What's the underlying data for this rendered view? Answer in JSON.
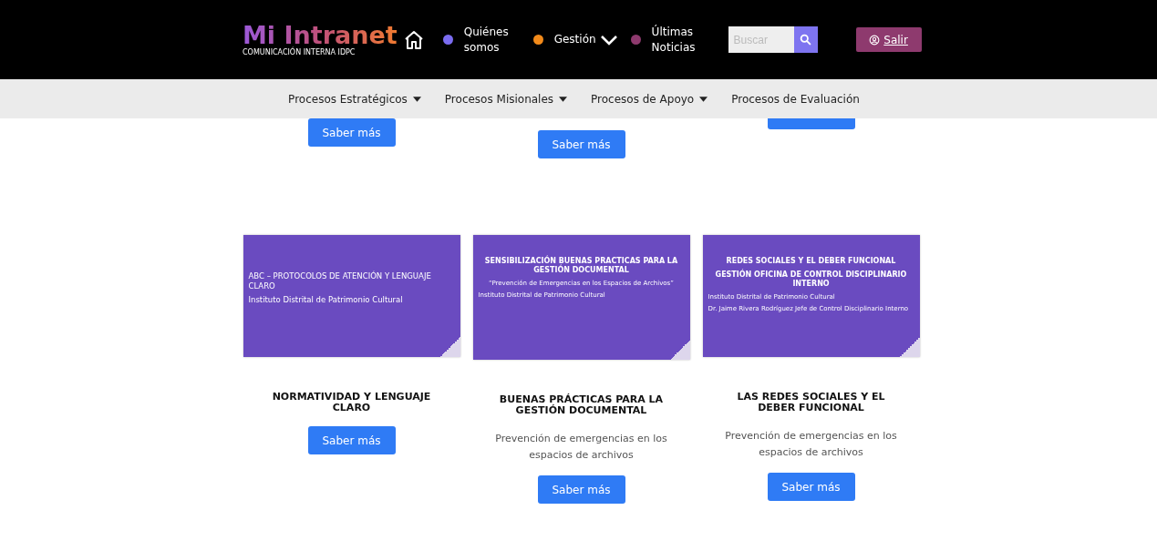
{
  "header": {
    "logo": {
      "title": "Mi Intranet",
      "subtitle": "COMUNICACIÓN INTERNA IDPC"
    },
    "nav": [
      {
        "label": "Quiénes somos",
        "color": "#7b6cf0",
        "dropdown": false
      },
      {
        "label": "Gestión",
        "color": "#f28a1a",
        "dropdown": true
      },
      {
        "label": "Últimas Noticias",
        "color": "#8e3a6e",
        "dropdown": false
      }
    ],
    "search": {
      "placeholder": "Buscar"
    },
    "logout": {
      "label": "Salir"
    }
  },
  "subnav": [
    {
      "label": "Procesos Estratégicos",
      "dropdown": true
    },
    {
      "label": "Procesos Misionales",
      "dropdown": true
    },
    {
      "label": "Procesos de Apoyo",
      "dropdown": true
    },
    {
      "label": "Procesos de Evaluación",
      "dropdown": false
    }
  ],
  "top_buttons": [
    {
      "kind": "full",
      "label": "Saber más"
    },
    {
      "kind": "full",
      "label": "Saber más"
    },
    {
      "kind": "clipped"
    }
  ],
  "cards": [
    {
      "slide": {
        "lines": [
          {
            "kind": "title",
            "text": "ABC – PROTOCOLOS DE ATENCIÓN Y LENGUAJE CLARO"
          },
          {
            "kind": "subtitle",
            "text": "Instituto Distrital de Patrimonio Cultural"
          }
        ]
      },
      "title": "NORMATIVIDAD Y LENGUAJE CLARO",
      "button": "Saber más"
    },
    {
      "slide": {
        "lines": [
          {
            "kind": "title",
            "text": "SENSIBILIZACIÓN BUENAS PRACTICAS PARA LA  GESTIÓN DOCUMENTAL"
          },
          {
            "kind": "quote",
            "text": "“Prevención de Emergencias en los Espacios de Archivos”"
          },
          {
            "kind": "credit",
            "text": "Instituto Distrital de Patrimonio Cultural"
          }
        ]
      },
      "title": "BUENAS PRÁCTICAS PARA LA GESTIÓN DOCUMENTAL",
      "description": "Prevención de emergencias en los espacios de archivos",
      "button": "Saber más"
    },
    {
      "slide": {
        "lines": [
          {
            "kind": "title",
            "text": "REDES SOCIALES Y EL DEBER FUNCIONAL"
          },
          {
            "kind": "title",
            "text": "GESTIÓN OFICINA DE CONTROL DISCIPLINARIO INTERNO"
          },
          {
            "kind": "credit",
            "text": "Instituto Distrital de Patrimonio Cultural"
          },
          {
            "kind": "credit",
            "text": "Dr. Jaime Rivera Rodríguez Jefe de Control Disciplinario Interno"
          }
        ]
      },
      "title": "LAS REDES SOCIALES Y EL DEBER FUNCIONAL",
      "description": "Prevención de emergencias en los espacios de archivos",
      "button": "Saber más"
    }
  ]
}
